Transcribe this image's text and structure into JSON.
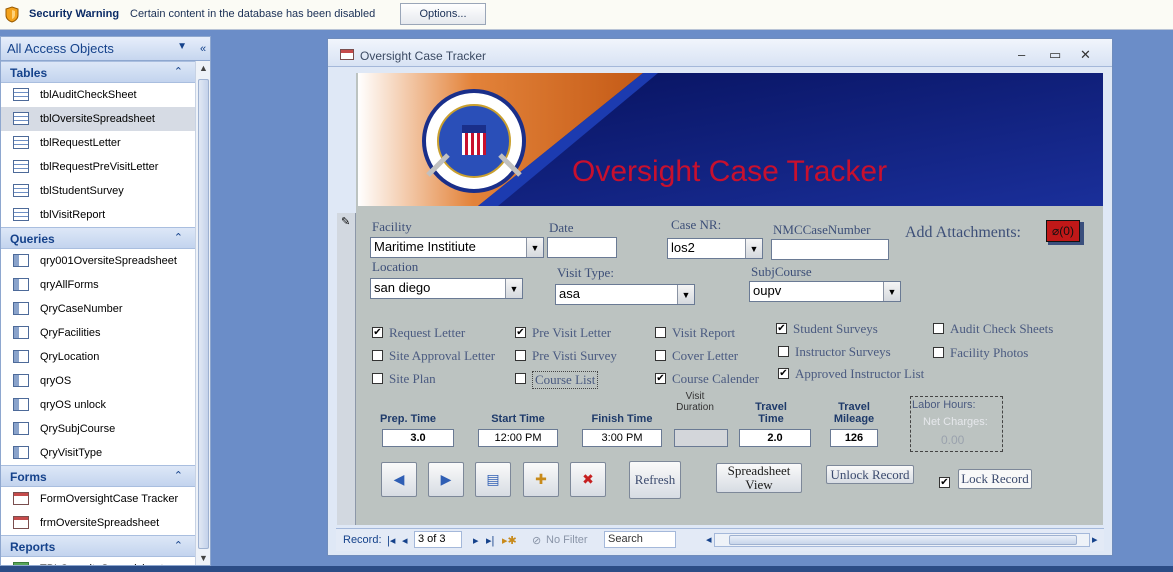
{
  "security_bar": {
    "title": "Security Warning",
    "message": "Certain content in the database has been disabled",
    "options_button": "Options..."
  },
  "nav_pane": {
    "header": "All Access Objects",
    "groups": [
      {
        "label": "Tables",
        "items": [
          "tblAuditCheckSheet",
          "tblOversiteSpreadsheet",
          "tblRequestLetter",
          "tblRequestPreVisitLetter",
          "tblStudentSurvey",
          "tblVisitReport"
        ]
      },
      {
        "label": "Queries",
        "items": [
          "qry001OversiteSpreadsheet",
          "qryAllForms",
          "QryCaseNumber",
          "QryFacilities",
          "QryLocation",
          "qryOS",
          "qryOS unlock",
          "QrySubjCourse",
          "QryVisitType"
        ]
      },
      {
        "label": "Forms",
        "items": [
          "FormOversightCase Tracker",
          "frmOversiteSpreadsheet"
        ]
      },
      {
        "label": "Reports",
        "items": [
          "TBLOversiteSpreadsheet"
        ]
      }
    ],
    "selected_item": "tblOversiteSpreadsheet"
  },
  "window": {
    "title": "Oversight Case Tracker",
    "controls": {
      "minimize": "–",
      "maximize": "▭",
      "close": "✕"
    }
  },
  "form": {
    "banner_title": "Oversight Case Tracker",
    "labels": {
      "facility": "Facility",
      "date": "Date",
      "case_nr": "Case NR:",
      "nmc_case_number": "NMCCaseNumber",
      "add_attachments": "Add Attachments:",
      "location": "Location",
      "visit_type": "Visit Type:",
      "subj_course": "SubjCourse"
    },
    "values": {
      "facility": "Maritime Institiute",
      "date": "",
      "case_nr": "los2",
      "nmc_case_number": "",
      "location": "san diego",
      "visit_type": "asa",
      "subj_course": "oupv",
      "attachments": "(0)"
    },
    "checkboxes": [
      {
        "label": "Request Letter",
        "checked": true
      },
      {
        "label": "Site Approval Letter",
        "checked": false
      },
      {
        "label": "Site Plan",
        "checked": false
      },
      {
        "label": "Pre Visit Letter",
        "checked": true
      },
      {
        "label": "Pre Visti Survey",
        "checked": false
      },
      {
        "label": "Course List",
        "checked": false
      },
      {
        "label": "Visit Report",
        "checked": false
      },
      {
        "label": "Cover Letter",
        "checked": false
      },
      {
        "label": "Course Calender",
        "checked": true
      },
      {
        "label": "Student Surveys",
        "checked": true
      },
      {
        "label": "Instructor Surveys",
        "checked": false
      },
      {
        "label": "Approved Instructor List",
        "checked": true
      },
      {
        "label": "Audit Check Sheets",
        "checked": false
      },
      {
        "label": "Facility Photos",
        "checked": false
      }
    ],
    "times": {
      "prep_label": "Prep. Time",
      "prep_value": "3.0",
      "start_label": "Start Time",
      "start_value": "12:00 PM",
      "finish_label": "Finish Time",
      "finish_value": "3:00 PM",
      "visit_duration_label": "Visit Duration",
      "visit_duration_value": "",
      "travel_time_label": "Travel Time",
      "travel_time_value": "2.0",
      "travel_mileage_label": "Travel Mileage",
      "travel_mileage_value": "126"
    },
    "labor": {
      "labor_hours": "Labor Hours:",
      "net_charges": "Net Charges:",
      "net_value": "0.00"
    },
    "buttons": {
      "refresh": "Refresh",
      "spreadsheet_view": "Spreadsheet View",
      "unlock_record": "Unlock Record",
      "lock_record": "Lock Record"
    },
    "lock_checked": true
  },
  "record_bar": {
    "label": "Record:",
    "position": "3 of 3",
    "filter": "No Filter",
    "search": "Search"
  },
  "colors": {
    "banner_bg": "#0b1a6b",
    "banner_title": "#c8102e",
    "form_bg": "#bcc3c1",
    "workspace_bg": "#6b8dc8"
  }
}
